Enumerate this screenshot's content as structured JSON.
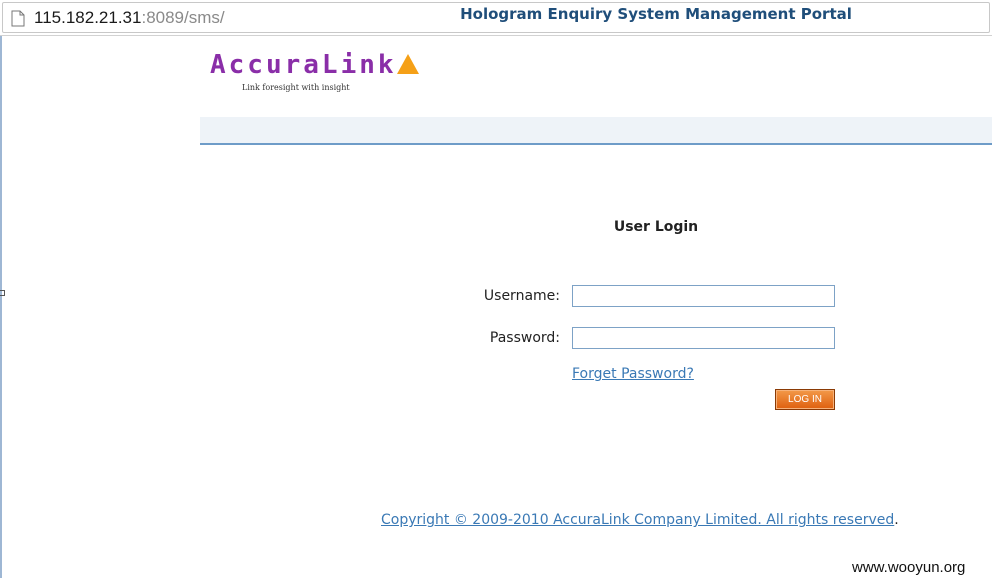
{
  "browser": {
    "url_host": "115.182.21.31",
    "url_path": ":8089/sms/"
  },
  "logo": {
    "text": "AccuraLink",
    "tagline": "Link foresight with insight",
    "brand_color": "#8a2ea8",
    "triangle_color": "#f5a017"
  },
  "header": {
    "title": "Hologram Enquiry System Management Portal"
  },
  "login": {
    "title": "User Login",
    "username_label": "Username:",
    "username_value": "",
    "password_label": "Password:",
    "password_value": "",
    "forget_link": "Forget Password?",
    "button_label": "LOG IN",
    "button_color": "#e8701e"
  },
  "footer": {
    "copyright": "Copyright © 2009-2010 AccuraLink Company Limited. All rights reserved",
    "trailing": "."
  },
  "watermark": {
    "text": "www.wooyun.org"
  }
}
